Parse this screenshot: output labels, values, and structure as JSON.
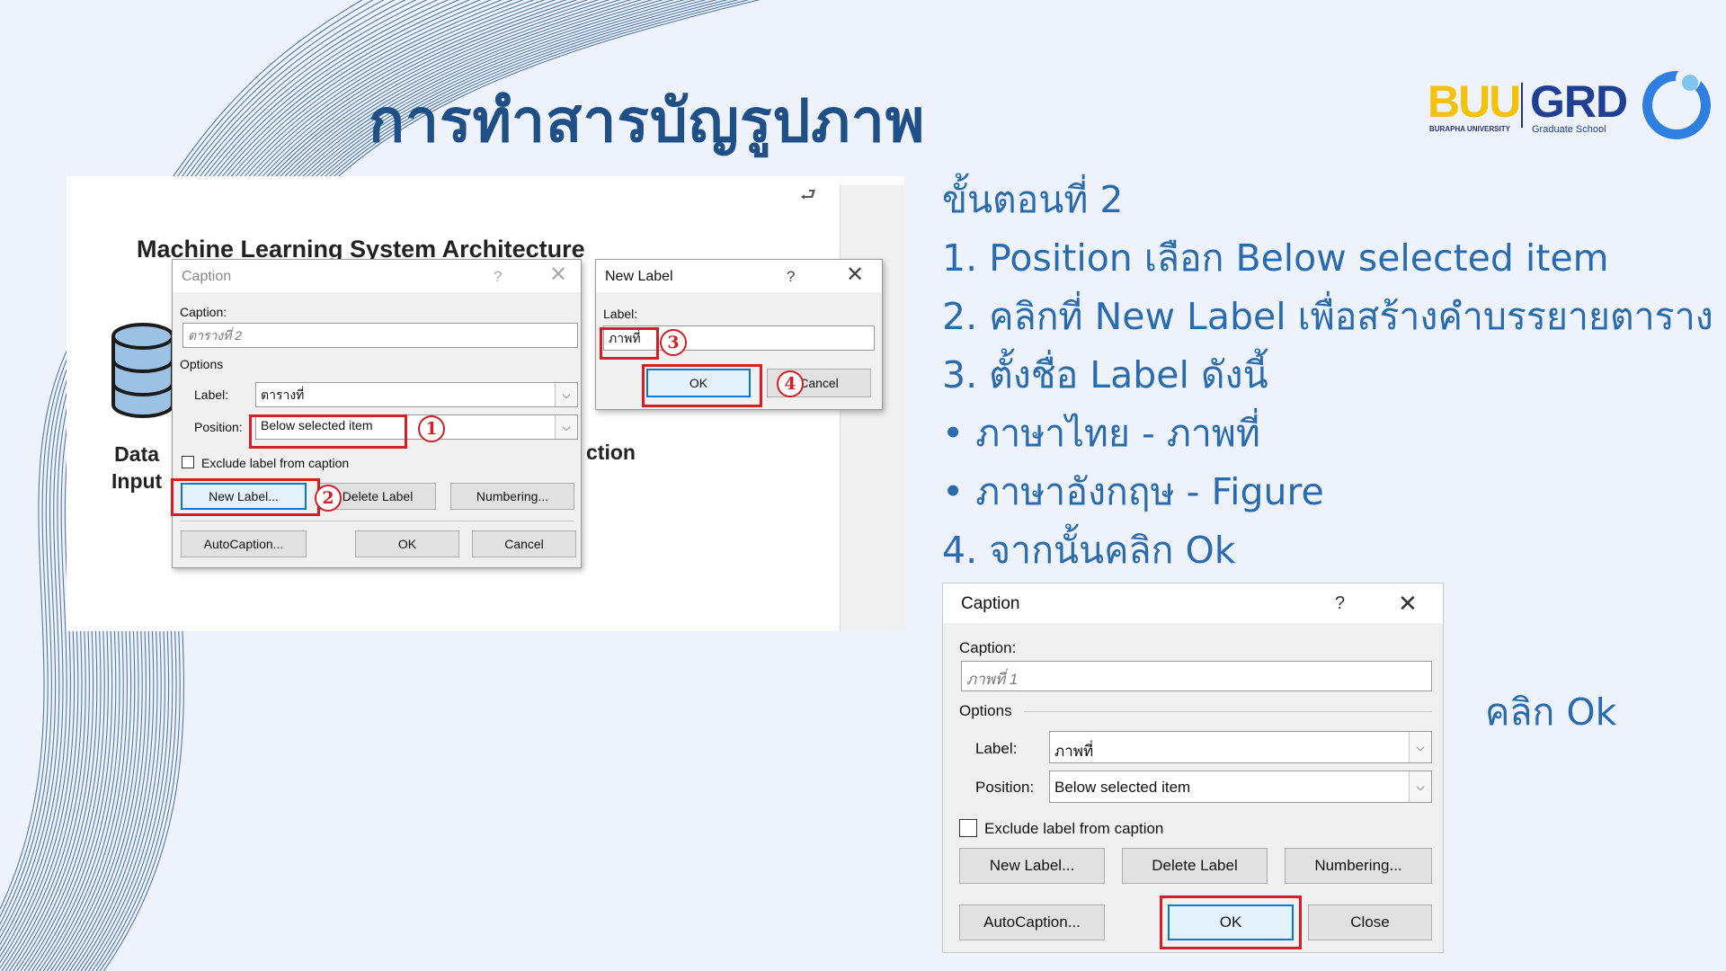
{
  "slide": {
    "title": "การทำสารบัญรูปภาพ",
    "logo": {
      "buu": "BUU",
      "buu_sub": "BURAPHA UNIVERSITY",
      "grd": "GRD",
      "grd_sub": "Graduate School"
    }
  },
  "screenshot": {
    "diagram_title": "Machine Learning System Architecture",
    "left_label_1": "Data",
    "left_label_2": "Input",
    "right_label": "ction",
    "caption_dialog": {
      "title": "Caption",
      "help": "?",
      "close": "✕",
      "caption_label": "Caption:",
      "caption_value": "ตารางที่ 2",
      "options_label": "Options",
      "label_label": "Label:",
      "label_value": "ตารางที่",
      "position_label": "Position:",
      "position_value": "Below selected item",
      "exclude_label": "Exclude label from caption",
      "new_label_btn": "New Label...",
      "delete_label_btn": "Delete Label",
      "numbering_btn": "Numbering...",
      "autocaption_btn": "AutoCaption...",
      "ok_btn": "OK",
      "cancel_btn": "Cancel"
    },
    "new_label_dialog": {
      "title": "New Label",
      "help": "?",
      "close": "✕",
      "label_label": "Label:",
      "label_value": "ภาพที่",
      "ok_btn": "OK",
      "cancel_btn": "Cancel"
    },
    "markers": [
      "1",
      "2",
      "3",
      "4"
    ]
  },
  "steps": [
    "ขั้นตอนที่ 2",
    "1.\tPosition เลือก Below selected item",
    "2.\tคลิกที่ New Label เพื่อสร้างคำบรรยายตาราง",
    "3.\tตั้งชื่อ Label ดังนี้",
    "•\tภาษาไทย - ภาพที่",
    "•\tภาษาอังกฤษ - Figure",
    "4.\tจากนั้นคลิก Ok"
  ],
  "note": "คลิก Ok",
  "result_dialog": {
    "title": "Caption",
    "help": "?",
    "close": "✕",
    "caption_label": "Caption:",
    "caption_value": "ภาพที่ 1",
    "options_label": "Options",
    "label_label": "Label:",
    "label_value": "ภาพที่",
    "position_label": "Position:",
    "position_value": "Below selected item",
    "exclude_label": "Exclude label from caption",
    "new_label_btn": "New Label...",
    "delete_label_btn": "Delete Label",
    "numbering_btn": "Numbering...",
    "autocaption_btn": "AutoCaption...",
    "ok_btn": "OK",
    "close_btn": "Close"
  },
  "colors": {
    "title": "#1e4f86",
    "steps": "#2a6bb0",
    "highlight": "#d51d24",
    "background": "#eef3fb"
  }
}
